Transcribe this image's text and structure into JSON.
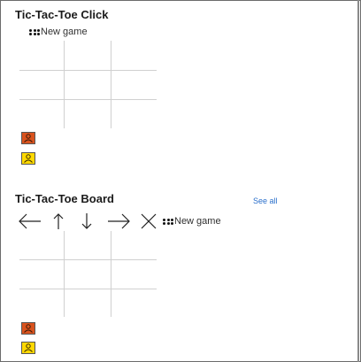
{
  "click_section": {
    "title": "Tic-Tac-Toe Click",
    "new_game_label": "New game"
  },
  "board_section": {
    "title": "Tic-Tac-Toe Board",
    "see_all_label": "See all",
    "new_game_label": "New game",
    "controls": [
      {
        "name": "arrow-left-icon"
      },
      {
        "name": "arrow-up-icon"
      },
      {
        "name": "arrow-down-icon"
      },
      {
        "name": "arrow-right-icon"
      },
      {
        "name": "close-icon"
      }
    ]
  },
  "players": [
    {
      "name": "player-1",
      "color": "#d9531e"
    },
    {
      "name": "player-2",
      "color": "#ffd800"
    }
  ]
}
